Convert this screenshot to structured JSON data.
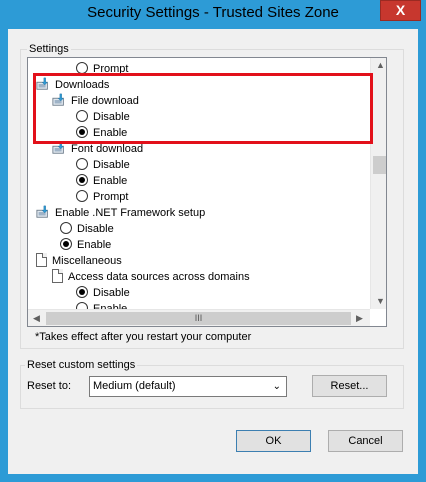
{
  "window": {
    "title": "Security Settings - Trusted Sites Zone",
    "close_glyph": "X"
  },
  "settings": {
    "group_label": "Settings",
    "rows": [
      {
        "kind": "radio",
        "label": "Prompt",
        "checked": false
      },
      {
        "kind": "category",
        "icon": "settings-category-icon",
        "label": "Downloads"
      },
      {
        "kind": "subcategory",
        "icon": "settings-category-icon",
        "label": "File download"
      },
      {
        "kind": "radio",
        "label": "Disable",
        "checked": false
      },
      {
        "kind": "radio",
        "label": "Enable",
        "checked": true
      },
      {
        "kind": "subcategory",
        "icon": "settings-category-icon",
        "label": "Font download"
      },
      {
        "kind": "radio",
        "label": "Disable",
        "checked": false
      },
      {
        "kind": "radio",
        "label": "Enable",
        "checked": true
      },
      {
        "kind": "radio",
        "label": "Prompt",
        "checked": false
      },
      {
        "kind": "category",
        "icon": "settings-category-icon",
        "label": "Enable .NET Framework setup"
      },
      {
        "kind": "radio",
        "label": "Disable",
        "checked": false
      },
      {
        "kind": "radio",
        "label": "Enable",
        "checked": true
      },
      {
        "kind": "category",
        "icon": "document-icon",
        "label": "Miscellaneous"
      },
      {
        "kind": "subcategory",
        "icon": "document-icon",
        "label": "Access data sources across domains"
      },
      {
        "kind": "radio",
        "label": "Disable",
        "checked": true
      },
      {
        "kind": "radio",
        "label": "Enable",
        "checked": false
      }
    ],
    "footnote": "*Takes effect after you restart your computer",
    "hscroll_thumb": "III"
  },
  "reset": {
    "group_label": "Reset custom settings",
    "reset_to_label": "Reset to:",
    "selected_value": "Medium (default)",
    "reset_button": "Reset..."
  },
  "footer": {
    "ok_label": "OK",
    "cancel_label": "Cancel"
  },
  "colors": {
    "titlebar": "#2d9bd6",
    "highlight": "#e2101a",
    "close": "#c7372e"
  }
}
